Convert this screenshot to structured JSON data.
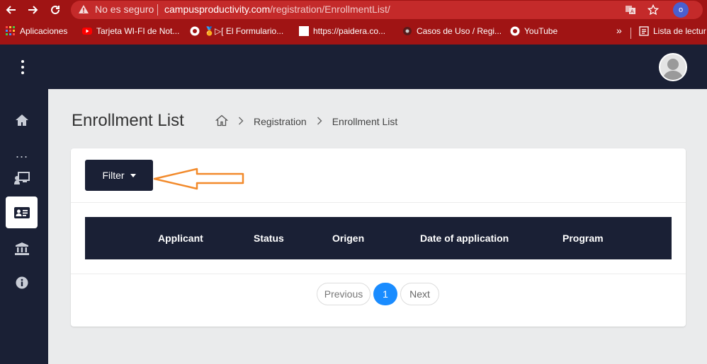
{
  "browser": {
    "insecure_label": "No es seguro",
    "url_host": "campusproductivity.com",
    "url_path": "/registration/EnrollmentList/",
    "profile_initial": "o",
    "icons": [
      "back-arrow-icon",
      "forward-arrow-icon",
      "reload-icon",
      "warning-icon",
      "translate-icon",
      "star-icon"
    ]
  },
  "bookmarks": {
    "items": [
      {
        "label": "Aplicaciones",
        "icon": "apps-grid-icon"
      },
      {
        "label": "Tarjeta WI-FI de Not...",
        "icon": "youtube-icon"
      },
      {
        "label": "🏅▷[ El Formulario...",
        "icon": "globe-icon"
      },
      {
        "label": "https://paidera.co...",
        "icon": "blank-page-icon"
      },
      {
        "label": "Casos de Uso / Regi...",
        "icon": "site-icon"
      },
      {
        "label": "YouTube",
        "icon": "globe-icon"
      }
    ],
    "overflow_label": "»",
    "reading_list_label": "Lista de lectur"
  },
  "header": {
    "menu_icon": "kebab-menu-icon",
    "avatar_icon": "user-avatar-icon"
  },
  "sidebar": {
    "items": [
      {
        "icon": "home-icon",
        "active": false
      },
      {
        "icon": "more-dots-icon",
        "active": false
      },
      {
        "icon": "teacher-board-icon",
        "active": false
      },
      {
        "icon": "id-card-icon",
        "active": true
      },
      {
        "icon": "institution-icon",
        "active": false
      },
      {
        "icon": "info-icon",
        "active": false
      }
    ]
  },
  "page": {
    "title": "Enrollment List",
    "breadcrumb": [
      "Registration",
      "Enrollment List"
    ]
  },
  "filter": {
    "label": "Filter"
  },
  "table": {
    "columns": [
      "Applicant",
      "Status",
      "Origen",
      "Date of application",
      "Program"
    ]
  },
  "pagination": {
    "previous": "Previous",
    "current_page": "1",
    "next": "Next"
  },
  "colors": {
    "browser_bar": "#a01414",
    "navy": "#1a2035",
    "page_active": "#1a8cff",
    "annotation_arrow": "#f28a2b"
  }
}
